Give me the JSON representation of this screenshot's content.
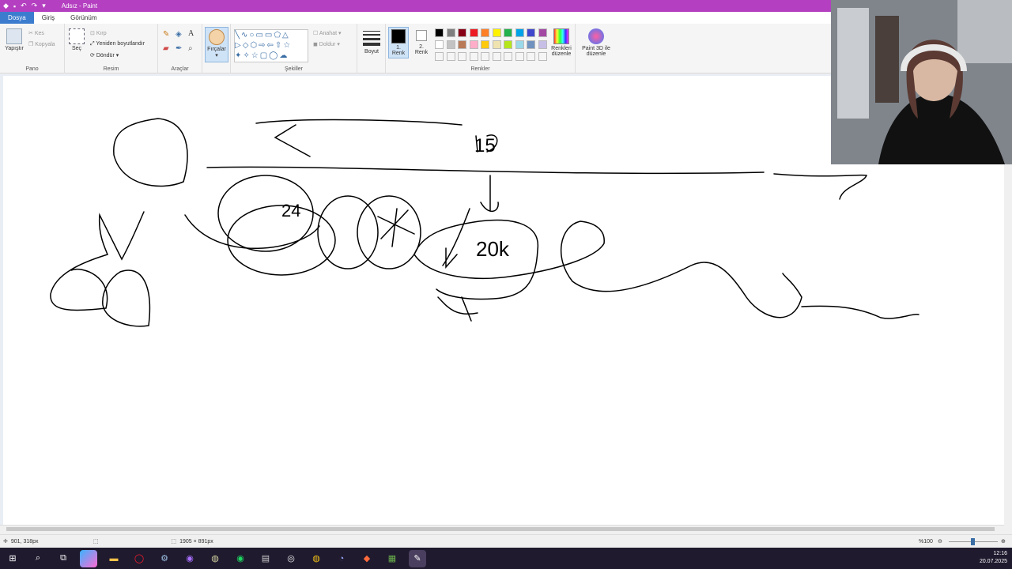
{
  "app": {
    "title": "Adsız - Paint"
  },
  "menu": {
    "file": "Dosya",
    "home": "Giriş",
    "view": "Görünüm"
  },
  "ribbon": {
    "clipboard": {
      "paste": "Yapıştır",
      "cut": "Kes",
      "copy": "Kopyala",
      "label": "Pano"
    },
    "image": {
      "select": "Seç",
      "crop": "Kırp",
      "resize": "Yeniden boyutlandır",
      "rotate": "Döndür",
      "label": "Resim"
    },
    "tools": {
      "label": "Araçlar",
      "text_tool": "A"
    },
    "brushes": {
      "label": "Fırçalar"
    },
    "shapes": {
      "outline": "Anahat",
      "fill": "Doldur",
      "label": "Şekiller"
    },
    "size": {
      "label": "Boyut"
    },
    "colors": {
      "color1_line1": "1.",
      "color1_line2": "Renk",
      "color2_line1": "2.",
      "color2_line2": "Renk",
      "edit_line1": "Renkleri",
      "edit_line2": "düzenle",
      "label": "Renkler",
      "color1": "#000000",
      "color2": "#ffffff",
      "palette_row1": [
        "#000000",
        "#7f7f7f",
        "#880015",
        "#ed1c24",
        "#ff7f27",
        "#fff200",
        "#22b14c",
        "#00a2e8",
        "#3f48cc",
        "#a349a4"
      ],
      "palette_row2": [
        "#ffffff",
        "#c3c3c3",
        "#b97a57",
        "#ffaec9",
        "#ffc90e",
        "#efe4b0",
        "#b5e61d",
        "#99d9ea",
        "#7092be",
        "#c8bfe7"
      ]
    },
    "paint3d": {
      "line1": "Paint 3D ile",
      "line2": "düzenle"
    }
  },
  "canvas_text": {
    "num_15": "15",
    "num_24": "24",
    "num_20": "20k"
  },
  "status": {
    "cursor_pos": "901, 318px",
    "canvas_size": "1905 × 891px",
    "zoom": "%100"
  },
  "taskbar": {
    "time": "12:16",
    "date": "20.07.2025"
  }
}
